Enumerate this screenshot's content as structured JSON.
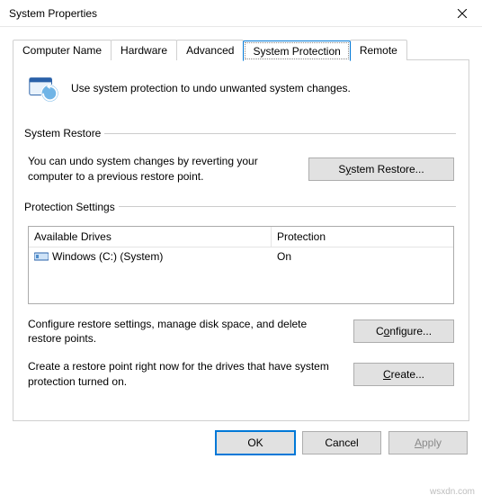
{
  "title": "System Properties",
  "tabs": {
    "computer_name": "Computer Name",
    "hardware": "Hardware",
    "advanced": "Advanced",
    "system_protection": "System Protection",
    "remote": "Remote"
  },
  "intro_text": "Use system protection to undo unwanted system changes.",
  "restore": {
    "legend": "System Restore",
    "text": "You can undo system changes by reverting your computer to a previous restore point.",
    "button_prefix": "S",
    "button_mn": "y",
    "button_suffix": "stem Restore..."
  },
  "protection": {
    "legend": "Protection Settings",
    "col_drives": "Available Drives",
    "col_protection": "Protection",
    "row_name": "Windows (C:) (System)",
    "row_status": "On",
    "configure_text": "Configure restore settings, manage disk space, and delete restore points.",
    "configure_prefix": "C",
    "configure_mn": "o",
    "configure_suffix": "nfigure...",
    "create_text": "Create a restore point right now for the drives that have system protection turned on.",
    "create_prefix": "",
    "create_mn": "C",
    "create_suffix": "reate..."
  },
  "buttons": {
    "ok": "OK",
    "cancel": "Cancel",
    "apply_mn": "A",
    "apply_suffix": "pply"
  },
  "watermark": "wsxdn.com"
}
